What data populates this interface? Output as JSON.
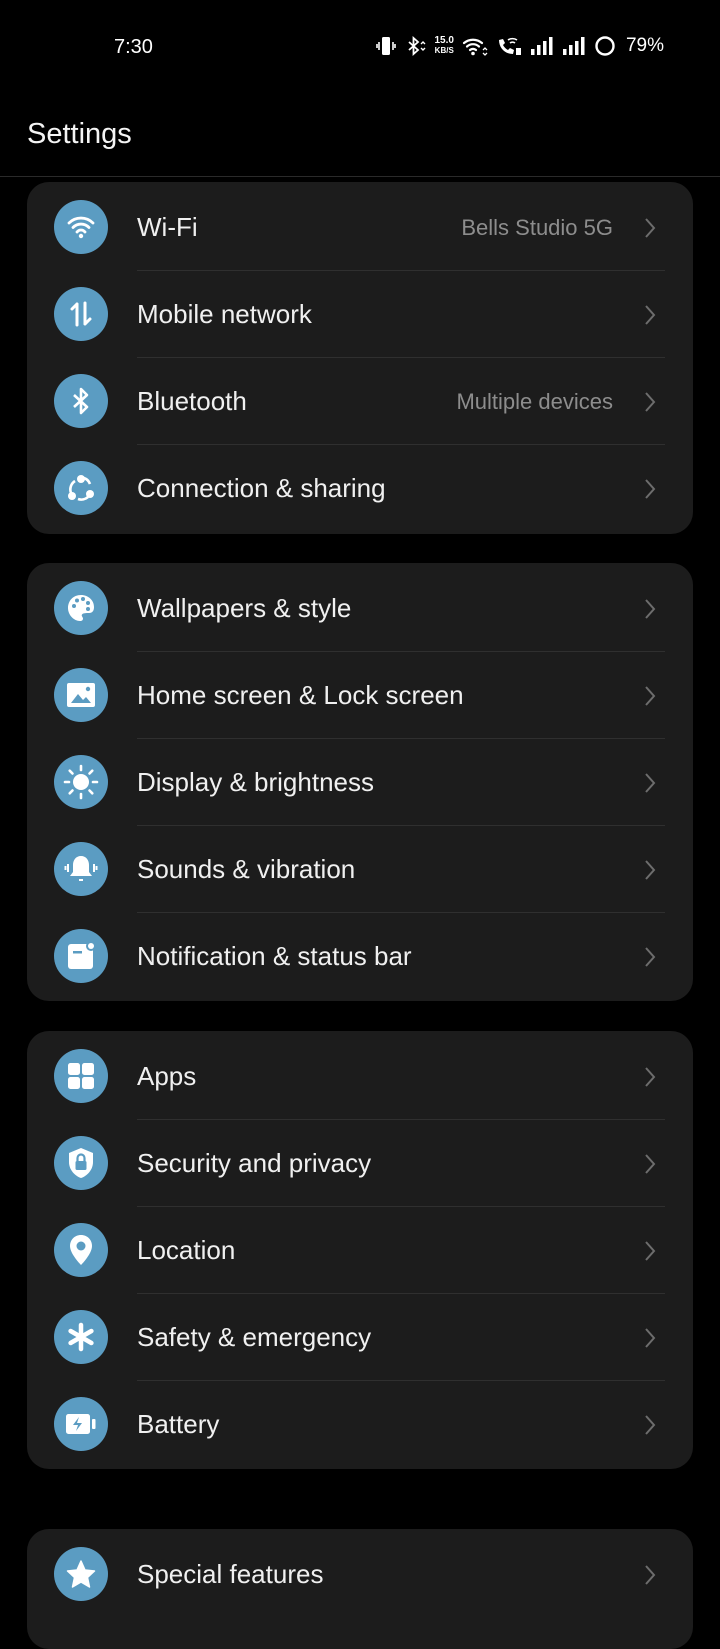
{
  "status_bar": {
    "time": "7:30",
    "net_speed_value": "15.0",
    "net_speed_unit": "KB/S",
    "battery_percent": "79%",
    "icons": [
      "vibrate-icon",
      "bluetooth-icon",
      "net-speed",
      "wifi-icon",
      "wifi-calling-icon",
      "signal-icon-sim1",
      "signal-icon-sim2",
      "battery-ring-icon"
    ]
  },
  "header": {
    "title": "Settings"
  },
  "colors": {
    "accent": "#5b9cc2",
    "card": "#1c1c1c",
    "background": "#000000"
  },
  "groups": [
    {
      "items": [
        {
          "label": "Wi-Fi",
          "value": "Bells Studio 5G",
          "icon": "wifi-icon"
        },
        {
          "label": "Mobile network",
          "value": "",
          "icon": "mobile-data-icon"
        },
        {
          "label": "Bluetooth",
          "value": "Multiple devices",
          "icon": "bluetooth-icon"
        },
        {
          "label": "Connection & sharing",
          "value": "",
          "icon": "share-icon"
        }
      ]
    },
    {
      "items": [
        {
          "label": "Wallpapers & style",
          "value": "",
          "icon": "palette-icon"
        },
        {
          "label": "Home screen & Lock screen",
          "value": "",
          "icon": "image-icon"
        },
        {
          "label": "Display & brightness",
          "value": "",
          "icon": "brightness-icon"
        },
        {
          "label": "Sounds & vibration",
          "value": "",
          "icon": "bell-icon"
        },
        {
          "label": "Notification & status bar",
          "value": "",
          "icon": "notification-icon"
        }
      ]
    },
    {
      "items": [
        {
          "label": "Apps",
          "value": "",
          "icon": "apps-grid-icon"
        },
        {
          "label": "Security and privacy",
          "value": "",
          "icon": "shield-lock-icon"
        },
        {
          "label": "Location",
          "value": "",
          "icon": "location-pin-icon"
        },
        {
          "label": "Safety & emergency",
          "value": "",
          "icon": "asterisk-icon"
        },
        {
          "label": "Battery",
          "value": "",
          "icon": "battery-charging-icon"
        }
      ]
    },
    {
      "items": [
        {
          "label": "Special features",
          "value": "",
          "icon": "star-icon"
        }
      ]
    }
  ]
}
